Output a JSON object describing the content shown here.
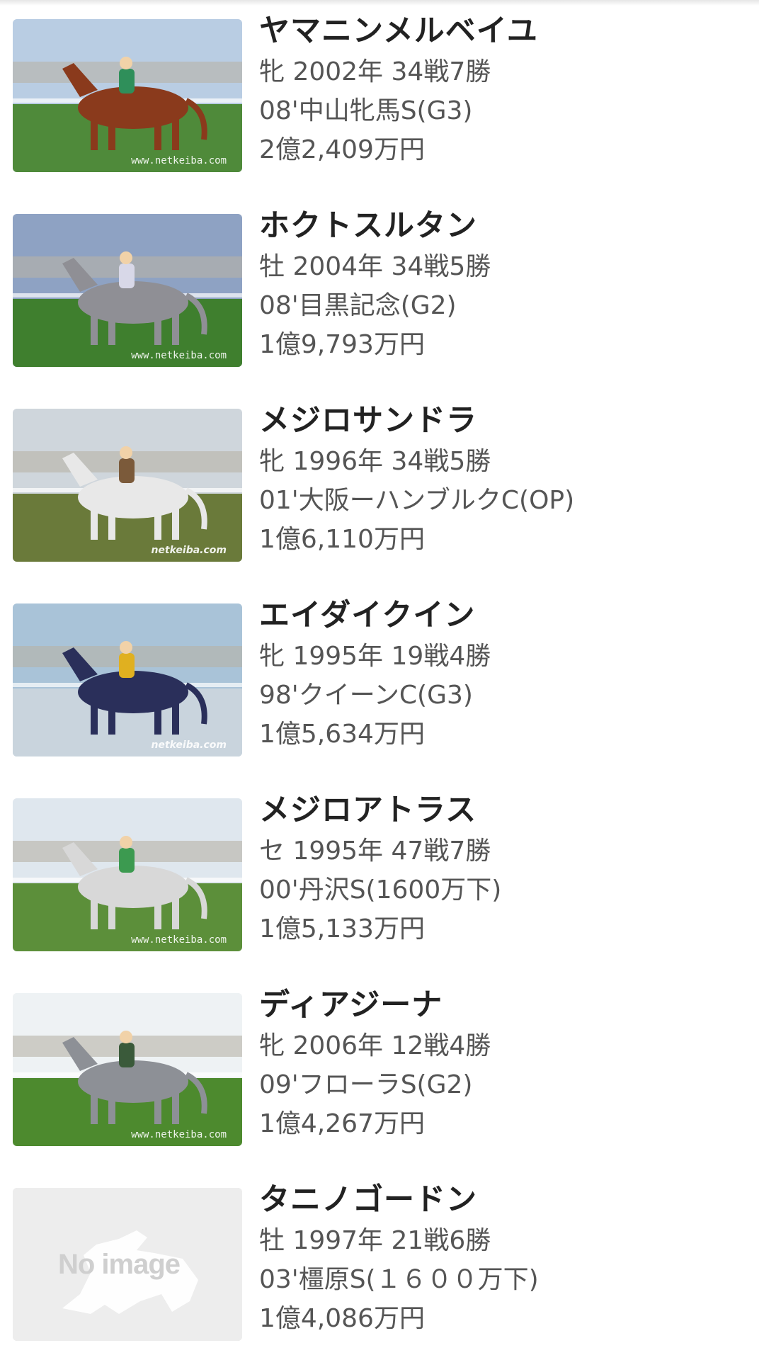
{
  "horses": [
    {
      "name": "ヤマニンメルベイユ",
      "profile": "牝 2002年 34戦7勝",
      "major_win": "08'中山牝馬S(G3)",
      "earnings": "2億2,409万円",
      "image_watermark": "www.netkeiba.com",
      "image_icon": "racehorse-photo-icon",
      "colors": {
        "sky": "#b9cde3",
        "turf": "#4f8a3a",
        "horse": "#8a3a1c",
        "jockey": "#2f8f5a"
      }
    },
    {
      "name": "ホクトスルタン",
      "profile": "牡 2004年 34戦5勝",
      "major_win": "08'目黒記念(G2)",
      "earnings": "1億9,793万円",
      "image_watermark": "www.netkeiba.com",
      "image_icon": "paddock-photo-icon",
      "colors": {
        "sky": "#8ea2c3",
        "turf": "#3f7f2e",
        "horse": "#8f8f95",
        "jockey": "#d8d8e8"
      }
    },
    {
      "name": "メジロサンドラ",
      "profile": "牝 1996年 34戦5勝",
      "major_win": "01'大阪ーハンブルクC(OP)",
      "earnings": "1億6,110万円",
      "image_watermark": "netkeiba.com",
      "image_icon": "grazing-horse-photo-icon",
      "colors": {
        "sky": "#cfd6dc",
        "turf": "#6a7a3a",
        "horse": "#e8e8e8",
        "jockey": "#7b5a3a"
      }
    },
    {
      "name": "エイダイクイン",
      "profile": "牝 1995年 19戦4勝",
      "major_win": "98'クイーンC(G3)",
      "earnings": "1億5,634万円",
      "image_watermark": "netkeiba.com",
      "image_icon": "racehorse-photo-icon",
      "colors": {
        "sky": "#a9c3d8",
        "turf": "#c9d4dd",
        "horse": "#2a2f5a",
        "jockey": "#e0b020"
      }
    },
    {
      "name": "メジロアトラス",
      "profile": "セ 1995年 47戦7勝",
      "major_win": "00'丹沢S(1600万下)",
      "earnings": "1億5,133万円",
      "image_watermark": "www.netkeiba.com",
      "image_icon": "race-pack-photo-icon",
      "colors": {
        "sky": "#dfe7ee",
        "turf": "#5c8f3a",
        "horse": "#d8d8d8",
        "jockey": "#3c9a50"
      }
    },
    {
      "name": "ディアジーナ",
      "profile": "牝 2006年 12戦4勝",
      "major_win": "09'フローラS(G2)",
      "earnings": "1億4,267万円",
      "image_watermark": "www.netkeiba.com",
      "image_icon": "standing-horse-photo-icon",
      "colors": {
        "sky": "#eef2f4",
        "turf": "#4d8a2e",
        "horse": "#8d9096",
        "jockey": "#3a5a3a"
      }
    },
    {
      "name": "タニノゴードン",
      "profile": "牡 1997年 21戦6勝",
      "major_win": "03'橿原S(１６００万下)",
      "earnings": "1億4,086万円",
      "image_placeholder": "No image",
      "image_icon": "no-image-horse-icon"
    }
  ]
}
